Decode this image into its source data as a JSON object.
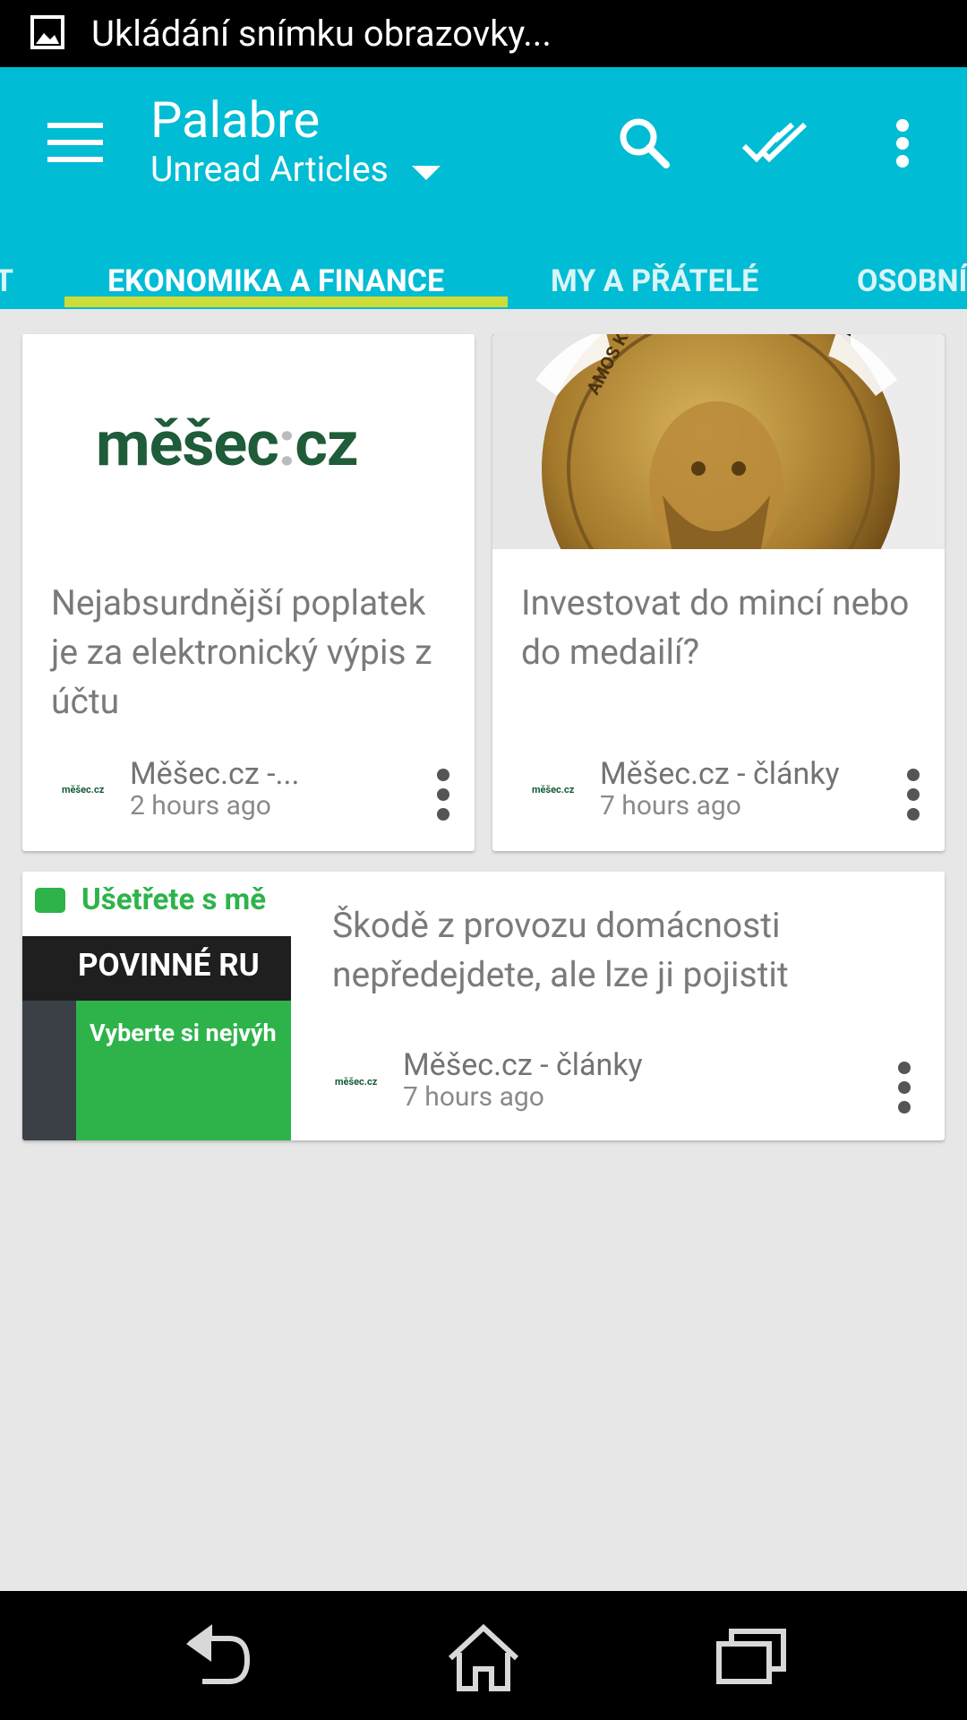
{
  "status_bar": {
    "notification_text": "Ukládání snímku obrazovky..."
  },
  "app_bar": {
    "title": "Palabre",
    "subtitle": "Unread Articles",
    "actions": [
      "search-icon",
      "mark-all-read-icon",
      "overflow-menu-icon"
    ]
  },
  "tabs": [
    {
      "label": "T",
      "active": false
    },
    {
      "label": "EKONOMIKA A FINANCE",
      "active": true
    },
    {
      "label": "MY A PŘÁTELÉ",
      "active": false
    },
    {
      "label": "OSOBNÍ",
      "active": false
    }
  ],
  "articles": [
    {
      "image_logo_text": "měšec",
      "image_logo_suffix": "cz",
      "title": "Nejabsurdnější poplatek je za elektronický výpis z účtu",
      "source_logo": "měšec.cz",
      "source": "Měšec.cz -...",
      "time": "2 hours ago"
    },
    {
      "image_coin_text": "AMOS KOMENSKÝ",
      "title": "Investovat do mincí nebo do medailí?",
      "source_logo": "měšec.cz",
      "source": "Měšec.cz - články",
      "time": "7 hours ago"
    },
    {
      "banner_top": "Ušetřete s mě",
      "banner_mid": "POVINNÉ RU",
      "banner_low": "Vyberte si nejvýh",
      "title": "Škodě z provozu domácnosti nepředejdete, ale lze ji pojistit",
      "source_logo": "měšec.cz",
      "source": "Měšec.cz - články",
      "time": "7 hours ago"
    }
  ],
  "colors": {
    "primary": "#00bcd4",
    "accent": "#cddc39",
    "brand_green": "#155a35",
    "banner_green": "#2db34a"
  },
  "nav_bar": [
    "back-icon",
    "home-icon",
    "recents-icon"
  ]
}
